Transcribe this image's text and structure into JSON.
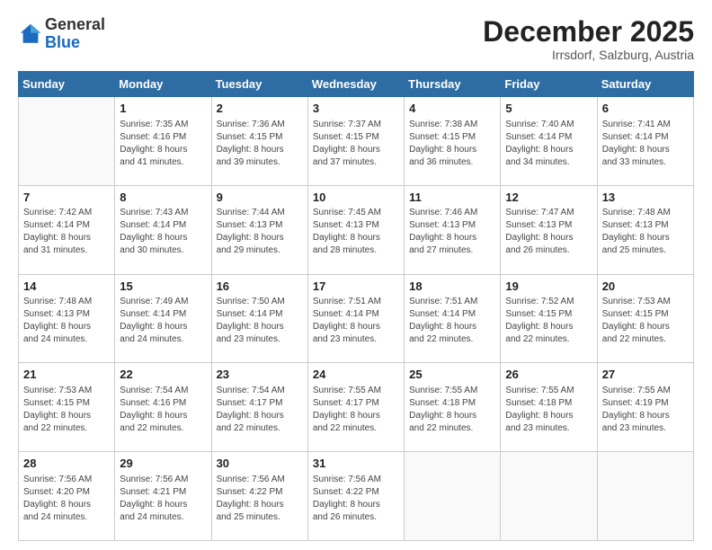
{
  "header": {
    "logo_general": "General",
    "logo_blue": "Blue",
    "month_title": "December 2025",
    "location": "Irrsdorf, Salzburg, Austria"
  },
  "days_of_week": [
    "Sunday",
    "Monday",
    "Tuesday",
    "Wednesday",
    "Thursday",
    "Friday",
    "Saturday"
  ],
  "weeks": [
    [
      {
        "day": "",
        "info": ""
      },
      {
        "day": "1",
        "info": "Sunrise: 7:35 AM\nSunset: 4:16 PM\nDaylight: 8 hours\nand 41 minutes."
      },
      {
        "day": "2",
        "info": "Sunrise: 7:36 AM\nSunset: 4:15 PM\nDaylight: 8 hours\nand 39 minutes."
      },
      {
        "day": "3",
        "info": "Sunrise: 7:37 AM\nSunset: 4:15 PM\nDaylight: 8 hours\nand 37 minutes."
      },
      {
        "day": "4",
        "info": "Sunrise: 7:38 AM\nSunset: 4:15 PM\nDaylight: 8 hours\nand 36 minutes."
      },
      {
        "day": "5",
        "info": "Sunrise: 7:40 AM\nSunset: 4:14 PM\nDaylight: 8 hours\nand 34 minutes."
      },
      {
        "day": "6",
        "info": "Sunrise: 7:41 AM\nSunset: 4:14 PM\nDaylight: 8 hours\nand 33 minutes."
      }
    ],
    [
      {
        "day": "7",
        "info": "Sunrise: 7:42 AM\nSunset: 4:14 PM\nDaylight: 8 hours\nand 31 minutes."
      },
      {
        "day": "8",
        "info": "Sunrise: 7:43 AM\nSunset: 4:14 PM\nDaylight: 8 hours\nand 30 minutes."
      },
      {
        "day": "9",
        "info": "Sunrise: 7:44 AM\nSunset: 4:13 PM\nDaylight: 8 hours\nand 29 minutes."
      },
      {
        "day": "10",
        "info": "Sunrise: 7:45 AM\nSunset: 4:13 PM\nDaylight: 8 hours\nand 28 minutes."
      },
      {
        "day": "11",
        "info": "Sunrise: 7:46 AM\nSunset: 4:13 PM\nDaylight: 8 hours\nand 27 minutes."
      },
      {
        "day": "12",
        "info": "Sunrise: 7:47 AM\nSunset: 4:13 PM\nDaylight: 8 hours\nand 26 minutes."
      },
      {
        "day": "13",
        "info": "Sunrise: 7:48 AM\nSunset: 4:13 PM\nDaylight: 8 hours\nand 25 minutes."
      }
    ],
    [
      {
        "day": "14",
        "info": "Sunrise: 7:48 AM\nSunset: 4:13 PM\nDaylight: 8 hours\nand 24 minutes."
      },
      {
        "day": "15",
        "info": "Sunrise: 7:49 AM\nSunset: 4:14 PM\nDaylight: 8 hours\nand 24 minutes."
      },
      {
        "day": "16",
        "info": "Sunrise: 7:50 AM\nSunset: 4:14 PM\nDaylight: 8 hours\nand 23 minutes."
      },
      {
        "day": "17",
        "info": "Sunrise: 7:51 AM\nSunset: 4:14 PM\nDaylight: 8 hours\nand 23 minutes."
      },
      {
        "day": "18",
        "info": "Sunrise: 7:51 AM\nSunset: 4:14 PM\nDaylight: 8 hours\nand 22 minutes."
      },
      {
        "day": "19",
        "info": "Sunrise: 7:52 AM\nSunset: 4:15 PM\nDaylight: 8 hours\nand 22 minutes."
      },
      {
        "day": "20",
        "info": "Sunrise: 7:53 AM\nSunset: 4:15 PM\nDaylight: 8 hours\nand 22 minutes."
      }
    ],
    [
      {
        "day": "21",
        "info": "Sunrise: 7:53 AM\nSunset: 4:15 PM\nDaylight: 8 hours\nand 22 minutes."
      },
      {
        "day": "22",
        "info": "Sunrise: 7:54 AM\nSunset: 4:16 PM\nDaylight: 8 hours\nand 22 minutes."
      },
      {
        "day": "23",
        "info": "Sunrise: 7:54 AM\nSunset: 4:17 PM\nDaylight: 8 hours\nand 22 minutes."
      },
      {
        "day": "24",
        "info": "Sunrise: 7:55 AM\nSunset: 4:17 PM\nDaylight: 8 hours\nand 22 minutes."
      },
      {
        "day": "25",
        "info": "Sunrise: 7:55 AM\nSunset: 4:18 PM\nDaylight: 8 hours\nand 22 minutes."
      },
      {
        "day": "26",
        "info": "Sunrise: 7:55 AM\nSunset: 4:18 PM\nDaylight: 8 hours\nand 23 minutes."
      },
      {
        "day": "27",
        "info": "Sunrise: 7:55 AM\nSunset: 4:19 PM\nDaylight: 8 hours\nand 23 minutes."
      }
    ],
    [
      {
        "day": "28",
        "info": "Sunrise: 7:56 AM\nSunset: 4:20 PM\nDaylight: 8 hours\nand 24 minutes."
      },
      {
        "day": "29",
        "info": "Sunrise: 7:56 AM\nSunset: 4:21 PM\nDaylight: 8 hours\nand 24 minutes."
      },
      {
        "day": "30",
        "info": "Sunrise: 7:56 AM\nSunset: 4:22 PM\nDaylight: 8 hours\nand 25 minutes."
      },
      {
        "day": "31",
        "info": "Sunrise: 7:56 AM\nSunset: 4:22 PM\nDaylight: 8 hours\nand 26 minutes."
      },
      {
        "day": "",
        "info": ""
      },
      {
        "day": "",
        "info": ""
      },
      {
        "day": "",
        "info": ""
      }
    ]
  ]
}
